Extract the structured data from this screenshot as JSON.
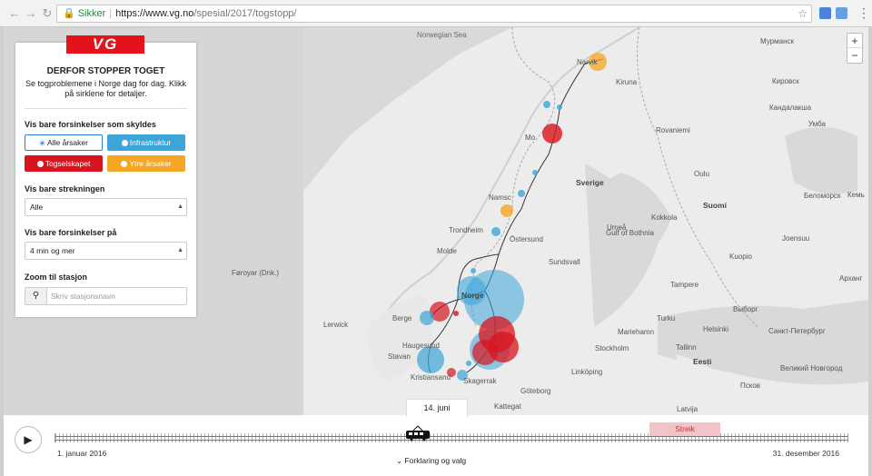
{
  "browser": {
    "secure_label": "Sikker",
    "url_host": "https://www.vg.no",
    "url_path": "/spesial/2017/togstopp/"
  },
  "panel": {
    "logo": "VG",
    "title": "DERFOR STOPPER TOGET",
    "subtitle": "Se togproblemene i Norge dag for dag. Klikk på sirklene for detaljer.",
    "cause_label": "Vis bare forsinkelser som skyldes",
    "causes": {
      "all": "Alle årsaker",
      "infra": "Infrastruktur",
      "tog": "Togselskapet",
      "ytre": "Ytre årsaker"
    },
    "line_label": "Vis bare strekningen",
    "line_value": "Alle",
    "delay_label": "Vis bare forsinkelser på",
    "delay_value": "4 min og mer",
    "zoom_label": "Zoom til stasjon",
    "search_placeholder": "Skriv stasjonsnavn"
  },
  "map": {
    "zoom_in": "+",
    "zoom_out": "−",
    "labels": {
      "norwegian_sea": "Norwegian Sea",
      "faroe": "Føroyar (Dnk.)",
      "lerwick": "Lerwick",
      "murmansk": "Мурманск",
      "kandalaksha": "Кандалакша",
      "umba": "Умба",
      "kirovsk": "Кировск",
      "belomorsk": "Беломорск",
      "kem": "Кемь",
      "vyborg": "Выборг",
      "spb": "Санкт-Петербург",
      "pskov": "Псков",
      "novgorod": "Великий Новгород",
      "norge": "Norge",
      "sverige": "Sverige",
      "suomi": "Suomi",
      "kiruna": "Kiruna",
      "narvik": "Narvik",
      "mo": "Mo",
      "rovaniemi": "Rovaniemi",
      "oulu": "Oulu",
      "kokkola": "Kokkola",
      "gulf": "Gulf of Bothnia",
      "umea": "Umeå",
      "ostersund": "Östersund",
      "sundsvall": "Sundsvall",
      "joensuu": "Joensuu",
      "kuopio": "Kuopio",
      "tampere": "Tampere",
      "turku": "Turku",
      "helsinki": "Helsinki",
      "stockholm": "Stockholm",
      "linkoping": "Linköping",
      "goteborg": "Göteborg",
      "kattegat": "Kattegat",
      "skagerrak": "Skagerrak",
      "bergen": "Berge",
      "molde": "Molde",
      "trondheim": "Trondheim",
      "namsos": "Namsc",
      "haugesund": "Haugesund",
      "stavanger": "Stavan",
      "kristiansand": "Kristiansand",
      "mariehamn": "Mariehamn",
      "eesti": "Eesti",
      "tallinn": "Tallinn",
      "latvija": "Latvija",
      "arhangelsk": "Арханг"
    }
  },
  "timeline": {
    "current_date": "14. juni",
    "start_date": "1. januar 2016",
    "end_date": "31. desember 2016",
    "strike_label": "Streik",
    "toggle_label": "Forklaring og valg"
  },
  "colors": {
    "infra": "#3da5d9",
    "tog": "#d9141e",
    "ytre": "#f5a623",
    "brand": "#e3121b"
  }
}
